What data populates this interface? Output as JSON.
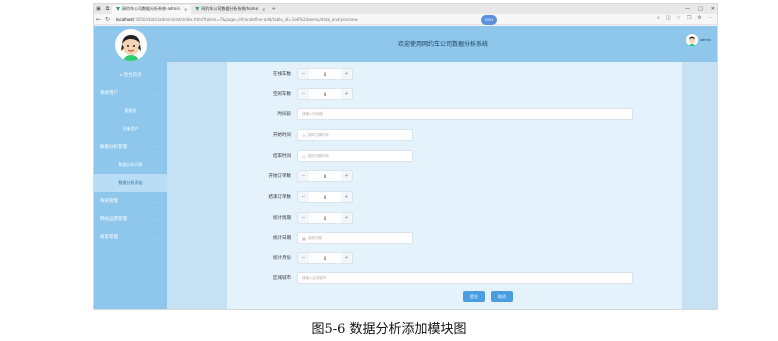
{
  "browser": {
    "tabs": [
      {
        "label": "网约车公司数据分析系统-admin"
      },
      {
        "label": "网约车公司数据分析系统/home"
      }
    ],
    "new_tab": "+",
    "url_host": "localhost",
    "url_path": ":5050/static/admin/dist/index.html?token=7&page=/#/undefine-add/table_id=1e6%2daemu/data_analysis/new",
    "badge": "2023",
    "window_controls": [
      "—",
      "□",
      "✕"
    ]
  },
  "app": {
    "title": "欢迎使用网约车公司数据分析系统",
    "user_name": "admin",
    "menu": [
      {
        "label": "后台首页",
        "type": "home"
      },
      {
        "label": "系统用户",
        "type": "group"
      },
      {
        "label": "管理员",
        "type": "sub"
      },
      {
        "label": "注册用户",
        "type": "sub"
      },
      {
        "label": "数据分析管理",
        "type": "group"
      },
      {
        "label": "数据分析列表",
        "type": "sub"
      },
      {
        "label": "数据分析添加",
        "type": "sub-active"
      },
      {
        "label": "系统管理",
        "type": "group"
      },
      {
        "label": "网站运营管理",
        "type": "group"
      },
      {
        "label": "商家管理",
        "type": "group"
      }
    ]
  },
  "form": {
    "fields": [
      {
        "label": "在线车数",
        "kind": "stepper",
        "value": "0"
      },
      {
        "label": "空闲车数",
        "kind": "stepper",
        "value": "0"
      },
      {
        "label": "时间段",
        "kind": "text",
        "placeholder": "请输入时间段"
      },
      {
        "label": "开始时间",
        "kind": "date",
        "placeholder": "选择日期时间"
      },
      {
        "label": "结束时间",
        "kind": "date",
        "placeholder": "选择日期时间"
      },
      {
        "label": "开始订单数",
        "kind": "stepper",
        "value": "0"
      },
      {
        "label": "结束订单数",
        "kind": "stepper",
        "value": "0"
      },
      {
        "label": "统计周期",
        "kind": "stepper",
        "value": "0"
      },
      {
        "label": "统计日期",
        "kind": "date",
        "placeholder": "选择日期"
      },
      {
        "label": "统计月份",
        "kind": "stepper",
        "value": "0"
      },
      {
        "label": "区域城市",
        "kind": "text",
        "placeholder": "请输入区域城市"
      }
    ],
    "submit_label": "提交",
    "cancel_label": "取消"
  },
  "caption": "图5-6 数据分析添加模块图",
  "colors": {
    "sidebar": "#8ec6ec",
    "content_bg": "#c6e1f4",
    "panel_bg": "#e4f2fc",
    "button": "#4a9ee0"
  }
}
